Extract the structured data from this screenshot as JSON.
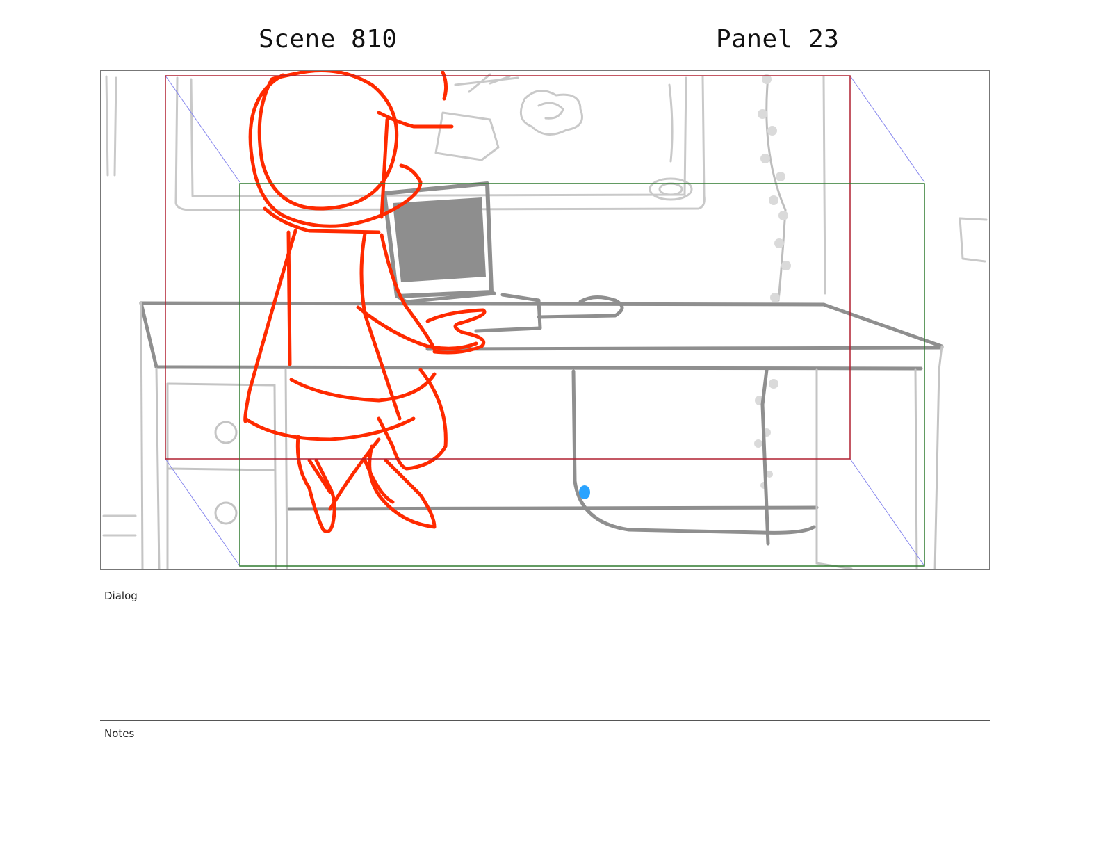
{
  "header": {
    "scene": "Scene 810",
    "panel": "Panel 23"
  },
  "sections": {
    "dialog_label": "Dialog",
    "notes_label": "Notes"
  },
  "colors": {
    "sketch_red": "#ff2a00",
    "background_line": "#9a9a9a",
    "safe_frame_red": "#b02030",
    "action_frame_green": "#2f7a2f",
    "camera_guide_blue": "#8888ee",
    "highlight_blue": "#29a3ff"
  }
}
